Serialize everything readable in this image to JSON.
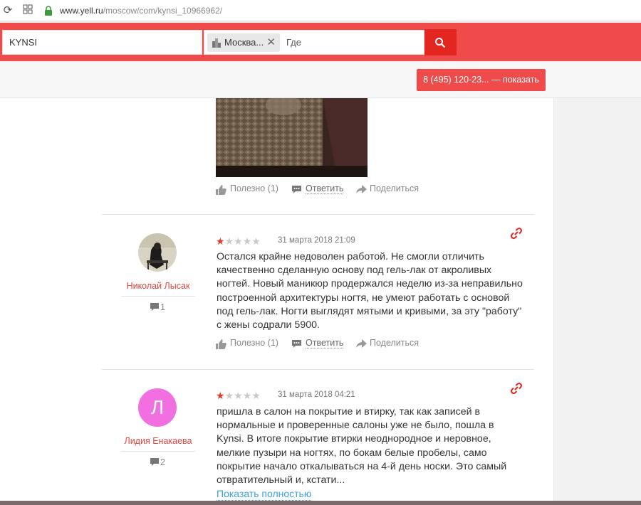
{
  "browser": {
    "url_domain": "www.yell.ru",
    "url_path": "/moscow/com/kynsi_10966962/"
  },
  "search": {
    "query": "KYNSI",
    "location_chip": "Москва...",
    "where_placeholder": "Где"
  },
  "header": {
    "phone_button": "8 (495) 120-23... — показать"
  },
  "actions_top": {
    "helpful": "Полезно (1)",
    "reply": "Ответить",
    "share": "Поделиться"
  },
  "reviews": [
    {
      "author": "Николай Лысак",
      "reviews_count": "1",
      "rating": 1,
      "rating_max": 5,
      "date": "31 марта 2018 21:09",
      "text": "Остался крайне недоволен работой. Не смогли отличить качественно сделанную основу под гель-лак от акроливых ногтей. Новый маникюр продержался неделю из-за неправильно построенной архитектуры ногтя, не умеют работать с основой под гель-лак. Ногти выглядят мятыми и кривыми, за эту \"работу\" с жены содрали 5900.",
      "helpful": "Полезно (1)",
      "reply": "Ответить",
      "share": "Поделиться"
    },
    {
      "author": "Лидия Енакаева",
      "avatar_letter": "Л",
      "reviews_count": "2",
      "rating": 1,
      "rating_max": 5,
      "date": "31 марта 2018 04:21",
      "text": "пришла в салон на покрытие и втирку, так как записей в нормальные и проверенные салоны уже не было, пошла в Kynsi. В итоге покрытие втирки неоднородное и неровное, мелкие пузыри на ногтях, по бокам белые пробелы, само покрытие начало откалываться на 4-й день носки. Это самый отвратительный и, кстати...",
      "show_more": "Показать полностью"
    }
  ],
  "colors": {
    "brand_red": "#f04b4b",
    "button_red": "#e3261f",
    "author_red": "#e0473e",
    "link_blue": "#3aa0d8",
    "avatar_pink": "#f16fe0"
  }
}
